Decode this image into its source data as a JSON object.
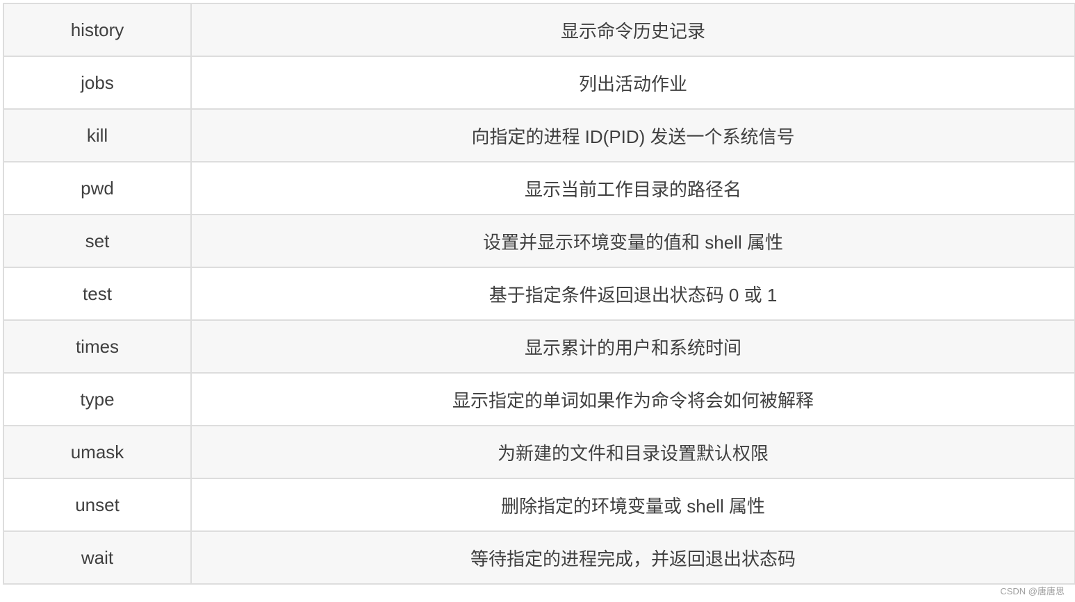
{
  "rows": [
    {
      "command": "history",
      "description": "显示命令历史记录"
    },
    {
      "command": "jobs",
      "description": "列出活动作业"
    },
    {
      "command": "kill",
      "description": "向指定的进程 ID(PID) 发送一个系统信号"
    },
    {
      "command": "pwd",
      "description": "显示当前工作目录的路径名"
    },
    {
      "command": "set",
      "description": "设置并显示环境变量的值和 shell 属性"
    },
    {
      "command": "test",
      "description": "基于指定条件返回退出状态码 0 或 1"
    },
    {
      "command": "times",
      "description": "显示累计的用户和系统时间"
    },
    {
      "command": "type",
      "description": "显示指定的单词如果作为命令将会如何被解释"
    },
    {
      "command": "umask",
      "description": "为新建的文件和目录设置默认权限"
    },
    {
      "command": "unset",
      "description": "删除指定的环境变量或 shell 属性"
    },
    {
      "command": "wait",
      "description": "等待指定的进程完成，并返回退出状态码"
    }
  ],
  "watermark": "CSDN @唐唐思"
}
